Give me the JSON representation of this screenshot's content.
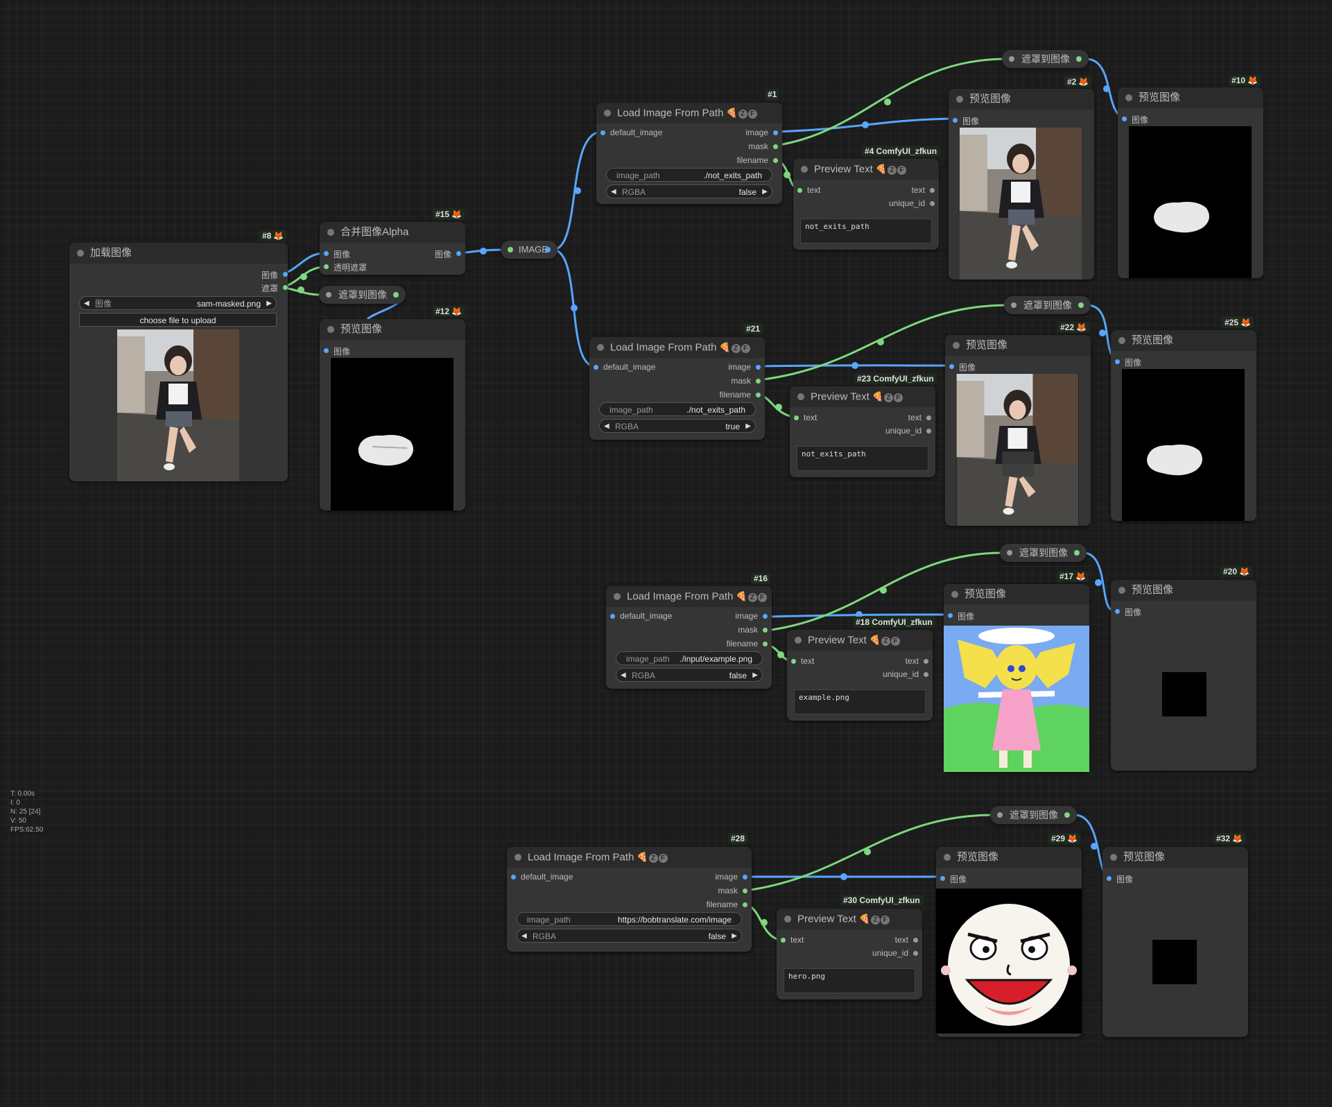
{
  "colors": {
    "image_wire": "#58a6ff",
    "mask_wire": "#7ed87e",
    "background": "#1c1c1c",
    "node": "#353535"
  },
  "nodes": {
    "n8": {
      "id": "#8",
      "title": "加载图像",
      "out_image": "图像",
      "out_mask": "遮罩",
      "combo_label": "图像",
      "combo_value": "sam-masked.png",
      "upload": "choose file to upload"
    },
    "n15": {
      "id": "#15",
      "title": "合并图像Alpha",
      "in_image": "图像",
      "in_alpha": "透明遮罩",
      "out_image": "图像"
    },
    "n12": {
      "id": "#12",
      "title": "预览图像",
      "in_image": "图像"
    },
    "reroute_image": {
      "label": "IMAGE"
    },
    "reroute_mask8": {
      "label": "遮罩到图像"
    },
    "n1": {
      "id": "#1",
      "title": "Load Image From Path",
      "in_default": "default_image",
      "out_image": "image",
      "out_mask": "mask",
      "out_filename": "filename",
      "path_label": "image_path",
      "path_value": "./not_exits_path",
      "rgba_label": "RGBA",
      "rgba_value": "false"
    },
    "n4": {
      "id": "#4 ComfyUI_zfkun",
      "title": "Preview Text",
      "in_text": "text",
      "out_text": "text",
      "out_uid": "unique_id",
      "text": "not_exits_path"
    },
    "n2": {
      "id": "#2",
      "title": "预览图像",
      "in_image": "图像"
    },
    "n10": {
      "id": "#10",
      "title": "预览图像",
      "in_image": "图像"
    },
    "mask1": {
      "label": "遮罩到图像"
    },
    "n21": {
      "id": "#21",
      "title": "Load Image From Path",
      "in_default": "default_image",
      "out_image": "image",
      "out_mask": "mask",
      "out_filename": "filename",
      "path_label": "image_path",
      "path_value": "./not_exits_path",
      "rgba_label": "RGBA",
      "rgba_value": "true"
    },
    "n23": {
      "id": "#23 ComfyUI_zfkun",
      "title": "Preview Text",
      "in_text": "text",
      "out_text": "text",
      "out_uid": "unique_id",
      "text": "not_exits_path"
    },
    "n22": {
      "id": "#22",
      "title": "预览图像",
      "in_image": "图像"
    },
    "n25": {
      "id": "#25",
      "title": "预览图像",
      "in_image": "图像"
    },
    "mask21": {
      "label": "遮罩到图像"
    },
    "n16": {
      "id": "#16",
      "title": "Load Image From Path",
      "in_default": "default_image",
      "out_image": "image",
      "out_mask": "mask",
      "out_filename": "filename",
      "path_label": "image_path",
      "path_value": "./input/example.png",
      "rgba_label": "RGBA",
      "rgba_value": "false"
    },
    "n18": {
      "id": "#18 ComfyUI_zfkun",
      "title": "Preview Text",
      "in_text": "text",
      "out_text": "text",
      "out_uid": "unique_id",
      "text": "example.png"
    },
    "n17": {
      "id": "#17",
      "title": "预览图像",
      "in_image": "图像"
    },
    "n20": {
      "id": "#20",
      "title": "预览图像",
      "in_image": "图像"
    },
    "mask16": {
      "label": "遮罩到图像"
    },
    "n28": {
      "id": "#28",
      "title": "Load Image From Path",
      "in_default": "default_image",
      "out_image": "image",
      "out_mask": "mask",
      "out_filename": "filename",
      "path_label": "image_path",
      "path_value": "https://bobtranslate.com/image",
      "rgba_label": "RGBA",
      "rgba_value": "false"
    },
    "n30": {
      "id": "#30 ComfyUI_zfkun",
      "title": "Preview Text",
      "in_text": "text",
      "out_text": "text",
      "out_uid": "unique_id",
      "text": "hero.png"
    },
    "n29": {
      "id": "#29",
      "title": "预览图像",
      "in_image": "图像"
    },
    "n32": {
      "id": "#32",
      "title": "预览图像",
      "in_image": "图像"
    },
    "mask28": {
      "label": "遮罩到图像"
    }
  },
  "stats": {
    "t": "T: 0.00s",
    "i": "I: 0",
    "n": "N: 25 [24]",
    "v": "V: 50",
    "fps": "FPS:62.50"
  }
}
